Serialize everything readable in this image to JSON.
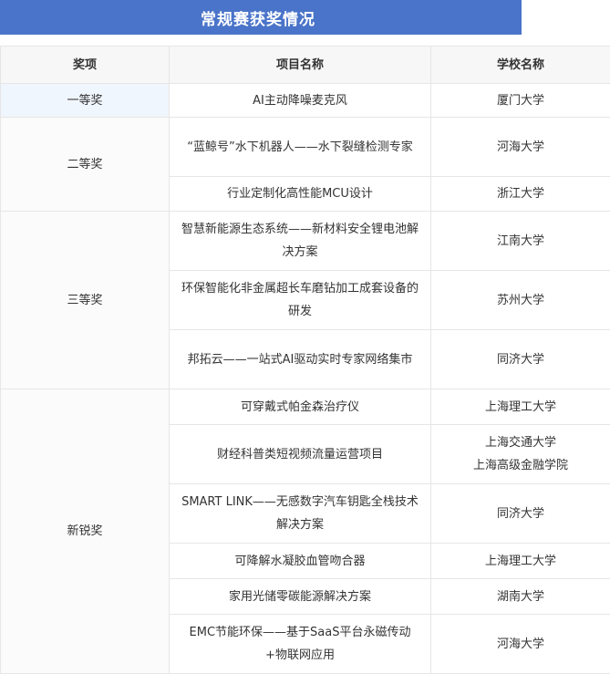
{
  "title": "常规赛获奖情况",
  "headers": {
    "award": "奖项",
    "project": "项目名称",
    "school": "学校名称"
  },
  "awards": [
    "一等奖",
    "二等奖",
    "三等奖",
    "新锐奖"
  ],
  "rows": [
    {
      "project": "AI主动降噪麦克风",
      "school": "厦门大学"
    },
    {
      "project": "“蓝鲸号”水下机器人——水下裂缝检测专家",
      "school": "河海大学"
    },
    {
      "project": "行业定制化高性能MCU设计",
      "school": "浙江大学"
    },
    {
      "project": "智慧新能源生态系统——新材料安全锂电池解决方案",
      "school": "江南大学"
    },
    {
      "project": "环保智能化非金属超长车磨钻加工成套设备的研发",
      "school": "苏州大学"
    },
    {
      "project": "邦拓云——一站式AI驱动实时专家网络集市",
      "school": "同济大学"
    },
    {
      "project": "可穿戴式帕金森治疗仪",
      "school": "上海理工大学"
    },
    {
      "project": "财经科普类短视频流量运营项目",
      "school": "上海交通大学",
      "school2": "上海高级金融学院"
    },
    {
      "project": "SMART LINK——无感数字汽车钥匙全栈技术解决方案",
      "school": "同济大学"
    },
    {
      "project": "可降解水凝胶血管吻合器",
      "school": "上海理工大学"
    },
    {
      "project": "家用光储零碳能源解决方案",
      "school": "湖南大学"
    },
    {
      "project": "EMC节能环保——基于SaaS平台永磁传动+物联网应用",
      "school": "河海大学"
    }
  ]
}
